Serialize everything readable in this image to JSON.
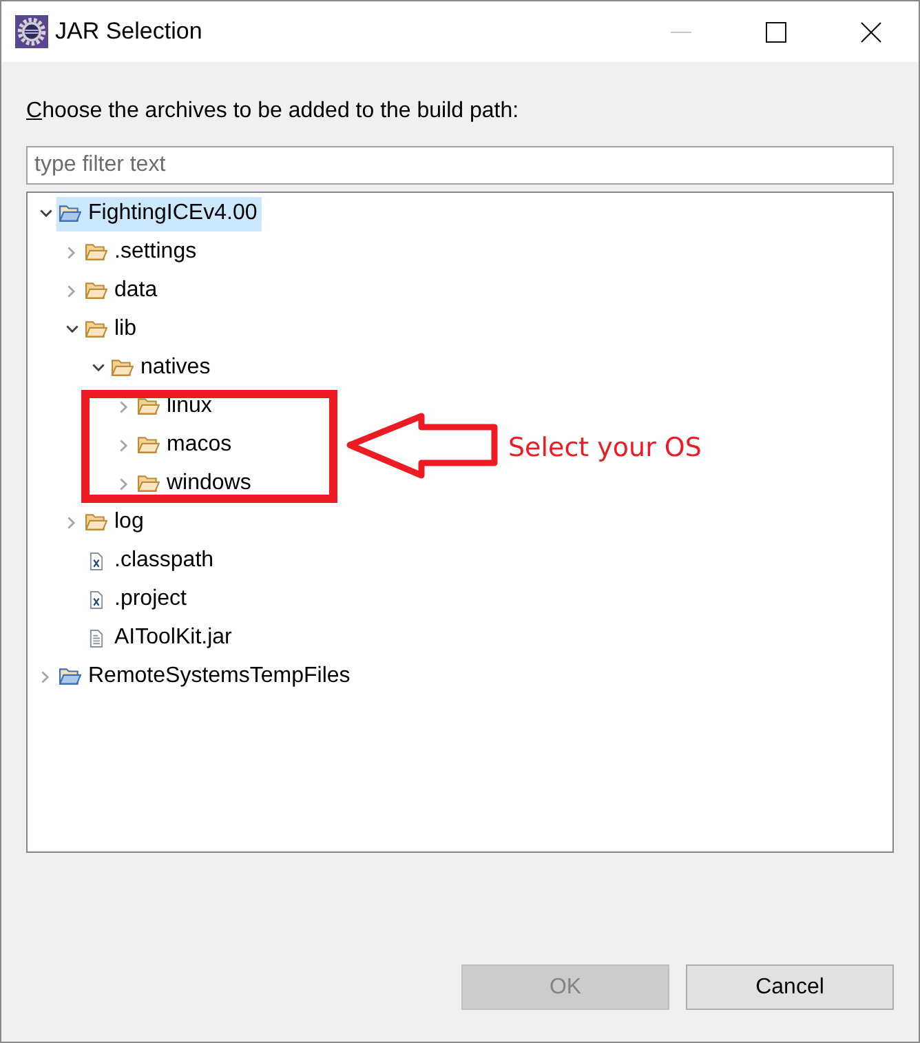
{
  "window": {
    "title": "JAR Selection",
    "buttons": [
      {
        "kind": "minimize",
        "disabled": true
      },
      {
        "kind": "maximize",
        "disabled": false
      },
      {
        "kind": "close",
        "disabled": false
      }
    ]
  },
  "instruction": {
    "text": "Choose the archives to be added to the build path:",
    "mnemonic_underlined": true
  },
  "filter": {
    "placeholder": "type filter text"
  },
  "tree": [
    {
      "label": "FightingICEv4.00",
      "kind": "project",
      "expanded": true,
      "selected": true,
      "children": [
        {
          "label": ".settings",
          "kind": "folder",
          "expanded": false,
          "selected": false
        },
        {
          "label": "data",
          "kind": "folder",
          "expanded": false,
          "selected": false
        },
        {
          "label": "lib",
          "kind": "folder",
          "expanded": true,
          "selected": false,
          "children": [
            {
              "label": "natives",
              "kind": "folder",
              "expanded": true,
              "selected": false,
              "children": [
                {
                  "label": "linux",
                  "kind": "folder",
                  "expanded": false,
                  "selected": false
                },
                {
                  "label": "macos",
                  "kind": "folder",
                  "expanded": false,
                  "selected": false
                },
                {
                  "label": "windows",
                  "kind": "folder",
                  "expanded": false,
                  "selected": false
                }
              ]
            }
          ]
        },
        {
          "label": "log",
          "kind": "folder",
          "expanded": false,
          "selected": false
        },
        {
          "label": ".classpath",
          "kind": "xml-file",
          "selected": false
        },
        {
          "label": ".project",
          "kind": "xml-file",
          "selected": false
        },
        {
          "label": "AIToolKit.jar",
          "kind": "jar-file",
          "selected": false
        }
      ]
    },
    {
      "label": "RemoteSystemsTempFiles",
      "kind": "project",
      "expanded": false,
      "selected": false
    }
  ],
  "annotation": {
    "text": "Select your OS"
  },
  "buttons": [
    {
      "label": "OK",
      "disabled": true
    },
    {
      "label": "Cancel",
      "disabled": false
    }
  ]
}
